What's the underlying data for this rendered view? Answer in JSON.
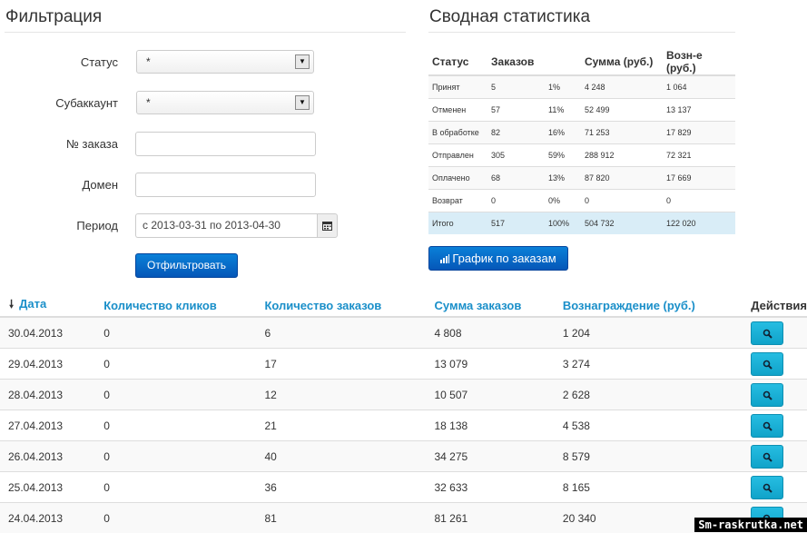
{
  "filter": {
    "title": "Фильтрация",
    "status_label": "Статус",
    "status_value": "*",
    "subaccount_label": "Субаккаунт",
    "subaccount_value": "*",
    "order_label": "№ заказа",
    "order_value": "",
    "domain_label": "Домен",
    "domain_value": "",
    "period_label": "Период",
    "period_value": "с 2013-03-31 по 2013-04-30",
    "submit_label": "Отфильтровать"
  },
  "summary": {
    "title": "Сводная статистика",
    "headers": [
      "Статус",
      "Заказов",
      "Сумма (руб.)",
      "Возн-е (руб.)"
    ],
    "rows": [
      {
        "status": "Принят",
        "orders": "5",
        "pct": "1%",
        "sum": "4 248",
        "reward": "1 064"
      },
      {
        "status": "Отменен",
        "orders": "57",
        "pct": "11%",
        "sum": "52 499",
        "reward": "13 137"
      },
      {
        "status": "В обработке",
        "orders": "82",
        "pct": "16%",
        "sum": "71 253",
        "reward": "17 829"
      },
      {
        "status": "Отправлен",
        "orders": "305",
        "pct": "59%",
        "sum": "288 912",
        "reward": "72 321"
      },
      {
        "status": "Оплачено",
        "orders": "68",
        "pct": "13%",
        "sum": "87 820",
        "reward": "17 669"
      },
      {
        "status": "Возврат",
        "orders": "0",
        "pct": "0%",
        "sum": "0",
        "reward": "0"
      },
      {
        "status": "Итого",
        "orders": "517",
        "pct": "100%",
        "sum": "504 732",
        "reward": "122 020"
      }
    ],
    "chart_button_label": "График по заказам"
  },
  "table": {
    "headers": {
      "date": "Дата",
      "clicks": "Количество кликов",
      "orders": "Количество заказов",
      "sum": "Сумма заказов",
      "reward": "Вознаграждение (руб.)",
      "actions": "Действия"
    },
    "rows": [
      {
        "date": "30.04.2013",
        "clicks": "0",
        "orders": "6",
        "sum": "4 808",
        "reward": "1 204"
      },
      {
        "date": "29.04.2013",
        "clicks": "0",
        "orders": "17",
        "sum": "13 079",
        "reward": "3 274"
      },
      {
        "date": "28.04.2013",
        "clicks": "0",
        "orders": "12",
        "sum": "10 507",
        "reward": "2 628"
      },
      {
        "date": "27.04.2013",
        "clicks": "0",
        "orders": "21",
        "sum": "18 138",
        "reward": "4 538"
      },
      {
        "date": "26.04.2013",
        "clicks": "0",
        "orders": "40",
        "sum": "34 275",
        "reward": "8 579"
      },
      {
        "date": "25.04.2013",
        "clicks": "0",
        "orders": "36",
        "sum": "32 633",
        "reward": "8 165"
      },
      {
        "date": "24.04.2013",
        "clicks": "0",
        "orders": "81",
        "sum": "81 261",
        "reward": "20 340"
      }
    ]
  },
  "watermark": "Sm-raskrutka.net",
  "colors": {
    "accent": "#1a8fc9",
    "primary_button": "#0a6fcf",
    "view_button": "#17b1d8",
    "total_row": "#d9edf7"
  }
}
